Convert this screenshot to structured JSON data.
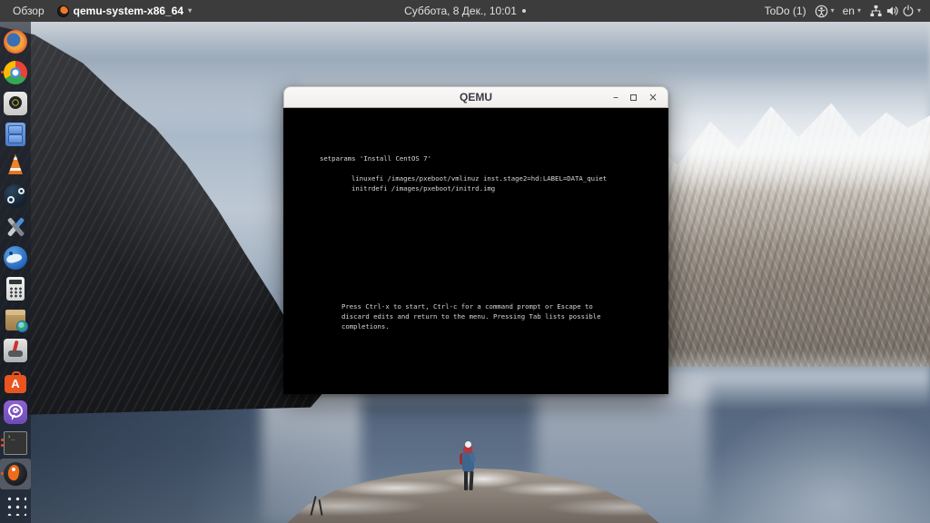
{
  "top_bar": {
    "activities": "Обзор",
    "focused_app": "qemu-system-x86_64",
    "clock": "Суббота, 8 Дек., 10:01",
    "todo": "ToDo (1)",
    "keyboard_layout": "en",
    "caret_glyph": "▾",
    "tray_icons": [
      "accessibility-icon",
      "wired-network-icon",
      "volume-icon",
      "power-icon"
    ]
  },
  "dock": {
    "items": [
      {
        "icon": "firefox-icon"
      },
      {
        "icon": "chromium-icon",
        "running_windows": 1
      },
      {
        "icon": "media-player-icon"
      },
      {
        "icon": "file-cabinet-icon"
      },
      {
        "icon": "vlc-icon"
      },
      {
        "icon": "steam-icon"
      },
      {
        "icon": "tools-icon"
      },
      {
        "icon": "thunderbird-icon"
      },
      {
        "icon": "calculator-icon"
      },
      {
        "icon": "package-globe-icon"
      },
      {
        "icon": "red-lever-icon"
      },
      {
        "icon": "ubuntu-software-icon",
        "badge_letter": "A"
      },
      {
        "icon": "viber-icon"
      },
      {
        "icon": "terminal-icon",
        "running_windows": 2
      },
      {
        "icon": "qemu-icon",
        "running_windows": 1,
        "focused": true
      },
      {
        "icon": "show-apps-icon"
      }
    ]
  },
  "window": {
    "title": "QEMU",
    "controls": {
      "minimize": "–",
      "maximize": "□",
      "close": "×"
    },
    "terminal": {
      "line1": "setparams 'Install CentOS 7'",
      "line2": "linuxefi /images/pxeboot/vmlinuz inst.stage2=hd:LABEL=DATA_quiet",
      "line3": "initrdefi /images/pxeboot/initrd.img",
      "help1": "Press Ctrl-x to start, Ctrl-c for a command prompt or Escape to",
      "help2": "discard edits and return to the menu. Pressing Tab lists possible",
      "help3": "completions."
    }
  },
  "colors": {
    "ubuntu_orange": "#e9541f",
    "top_bar_bg": "#3c3c3c",
    "dock_bg": "rgba(26,30,40,0.62)",
    "titlebar_bg": "#f5f4f2",
    "terminal_bg": "#000000",
    "terminal_text": "#d8d8d8"
  }
}
